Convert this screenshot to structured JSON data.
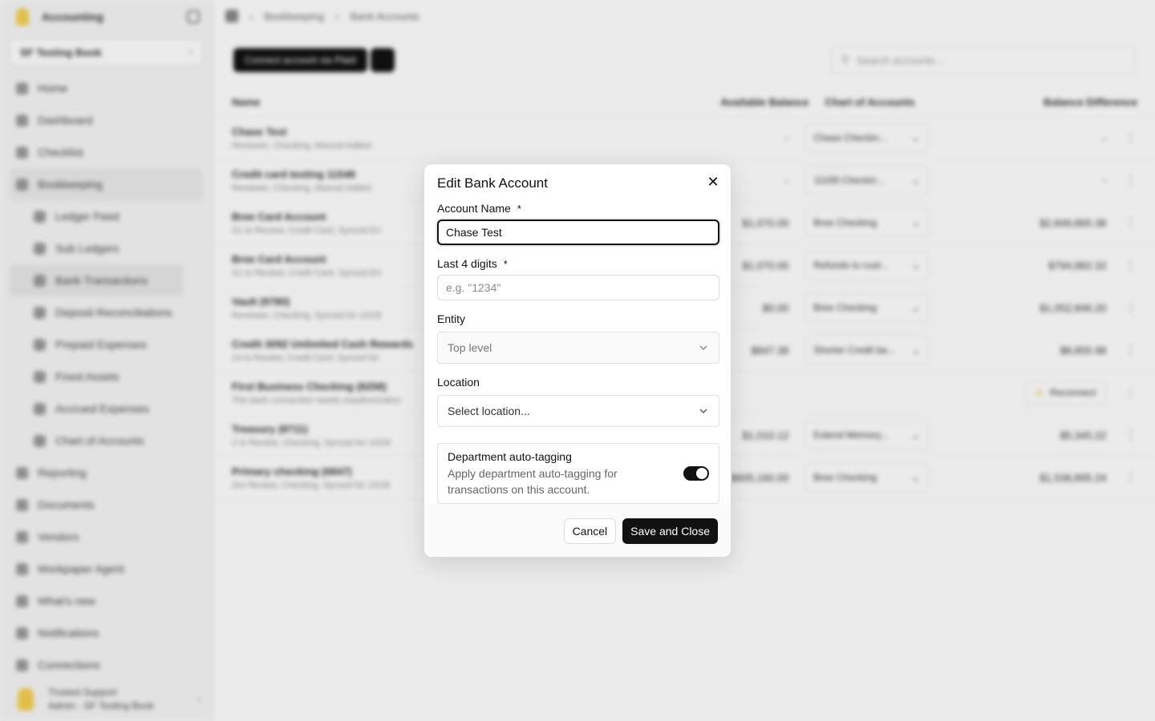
{
  "background": {
    "sidebar": {
      "brand": "Accounting",
      "workspace": "SF Testing Book",
      "items": [
        {
          "label": "Home"
        },
        {
          "label": "Dashboard"
        },
        {
          "label": "Checklist"
        },
        {
          "label": "Bookkeeping",
          "active": true
        },
        {
          "label": "Ledger Feed",
          "sub": true
        },
        {
          "label": "Sub Ledgers",
          "sub": true
        },
        {
          "label": "Bank Transactions",
          "sub": true,
          "active": true
        },
        {
          "label": "Deposit Reconciliations",
          "sub": true
        },
        {
          "label": "Prepaid Expenses",
          "sub": true
        },
        {
          "label": "Fixed Assets",
          "sub": true
        },
        {
          "label": "Accrued Expenses",
          "sub": true
        },
        {
          "label": "Chart of Accounts",
          "sub": true
        },
        {
          "label": "Reporting"
        },
        {
          "label": "Documents"
        },
        {
          "label": "Vendors"
        },
        {
          "label": "Workpaper Agent"
        },
        {
          "label": "What's new"
        },
        {
          "label": "Notifications"
        },
        {
          "label": "Connections"
        }
      ],
      "user_name": "Trusted Support",
      "user_role": "Admin - SF Testing Book"
    },
    "breadcrumb": [
      "Bookkeeping",
      "Bank Accounts"
    ],
    "connect_label": "Connect account via Plaid",
    "search_placeholder": "Search accounts...",
    "columns": [
      "Name",
      "Available Balance",
      "Chart of Accounts",
      "Balance Difference"
    ],
    "rows": [
      {
        "name": "Chase Test",
        "sub": "Reviewer, Checking, Manual Added",
        "bal": "-",
        "coa": "Chase Checkin...",
        "diff": "-"
      },
      {
        "name": "Credit card testing 11548",
        "sub": "Reviewer, Checking, Manual Added",
        "bal": "-",
        "coa": "11169 Checkin...",
        "diff": "-"
      },
      {
        "name": "Bree Card Account",
        "sub": "S1 to Review, Credit Card, Synced Err",
        "bal": "$1,070.00",
        "coa": "Bree Checking",
        "diff": "$2,849,865.38"
      },
      {
        "name": "Bree Card Account",
        "sub": "S1 to Review, Credit Card, Synced Err",
        "bal": "$1,070.00",
        "coa": "Refunds to cust...",
        "diff": "$794,882.32"
      },
      {
        "name": "Vault (9780)",
        "sub": "Reviewer, Checking, Synced for 10/28",
        "bal": "$0.00",
        "coa": "Bree Checking",
        "diff": "$1,052,846.20"
      },
      {
        "name": "Credit 3092 Unlimited Cash Rewards",
        "sub": "14 to Review, Credit Card, Synced for",
        "bal": "$847.38",
        "coa": "Shorter Credit ba...",
        "diff": "$8,855.98"
      },
      {
        "name": "First Business Checking (8258)",
        "sub": "The bank connection needs reauthorization",
        "bal": "",
        "coa": "",
        "diff": "Reconnect"
      },
      {
        "name": "Treasury (8711)",
        "sub": "2 to Review, Checking, Synced for 10/28",
        "bal": "$1,010.12",
        "coa": "Extend Memory...",
        "diff": "$5,345.22"
      },
      {
        "name": "Primary checking (6847)",
        "sub": "Are Review, Checking, Synced for 10/28",
        "bal": "$605,160.00",
        "coa": "Bree Checking",
        "diff": "$1,536,895.24"
      }
    ]
  },
  "modal": {
    "title": "Edit Bank Account",
    "account_name_label": "Account Name",
    "required_mark": "*",
    "account_name_value": "Chase Test",
    "last4_label": "Last 4 digits",
    "last4_placeholder": "e.g. \"1234\"",
    "entity_label": "Entity",
    "entity_value": "Top level",
    "location_label": "Location",
    "location_value": "Select location...",
    "auto_tag_title": "Department auto-tagging",
    "auto_tag_desc": "Apply department auto-tagging for transactions on this account.",
    "auto_tag_enabled": true,
    "cancel_label": "Cancel",
    "save_label": "Save and Close"
  },
  "icons": {
    "close": "close-icon",
    "chevron": "chevron-down-icon",
    "toggle": "toggle-switch"
  },
  "colors": {
    "primary": "#111111",
    "border": "#dcdcdc",
    "brand_logo": "#f5cf52"
  }
}
